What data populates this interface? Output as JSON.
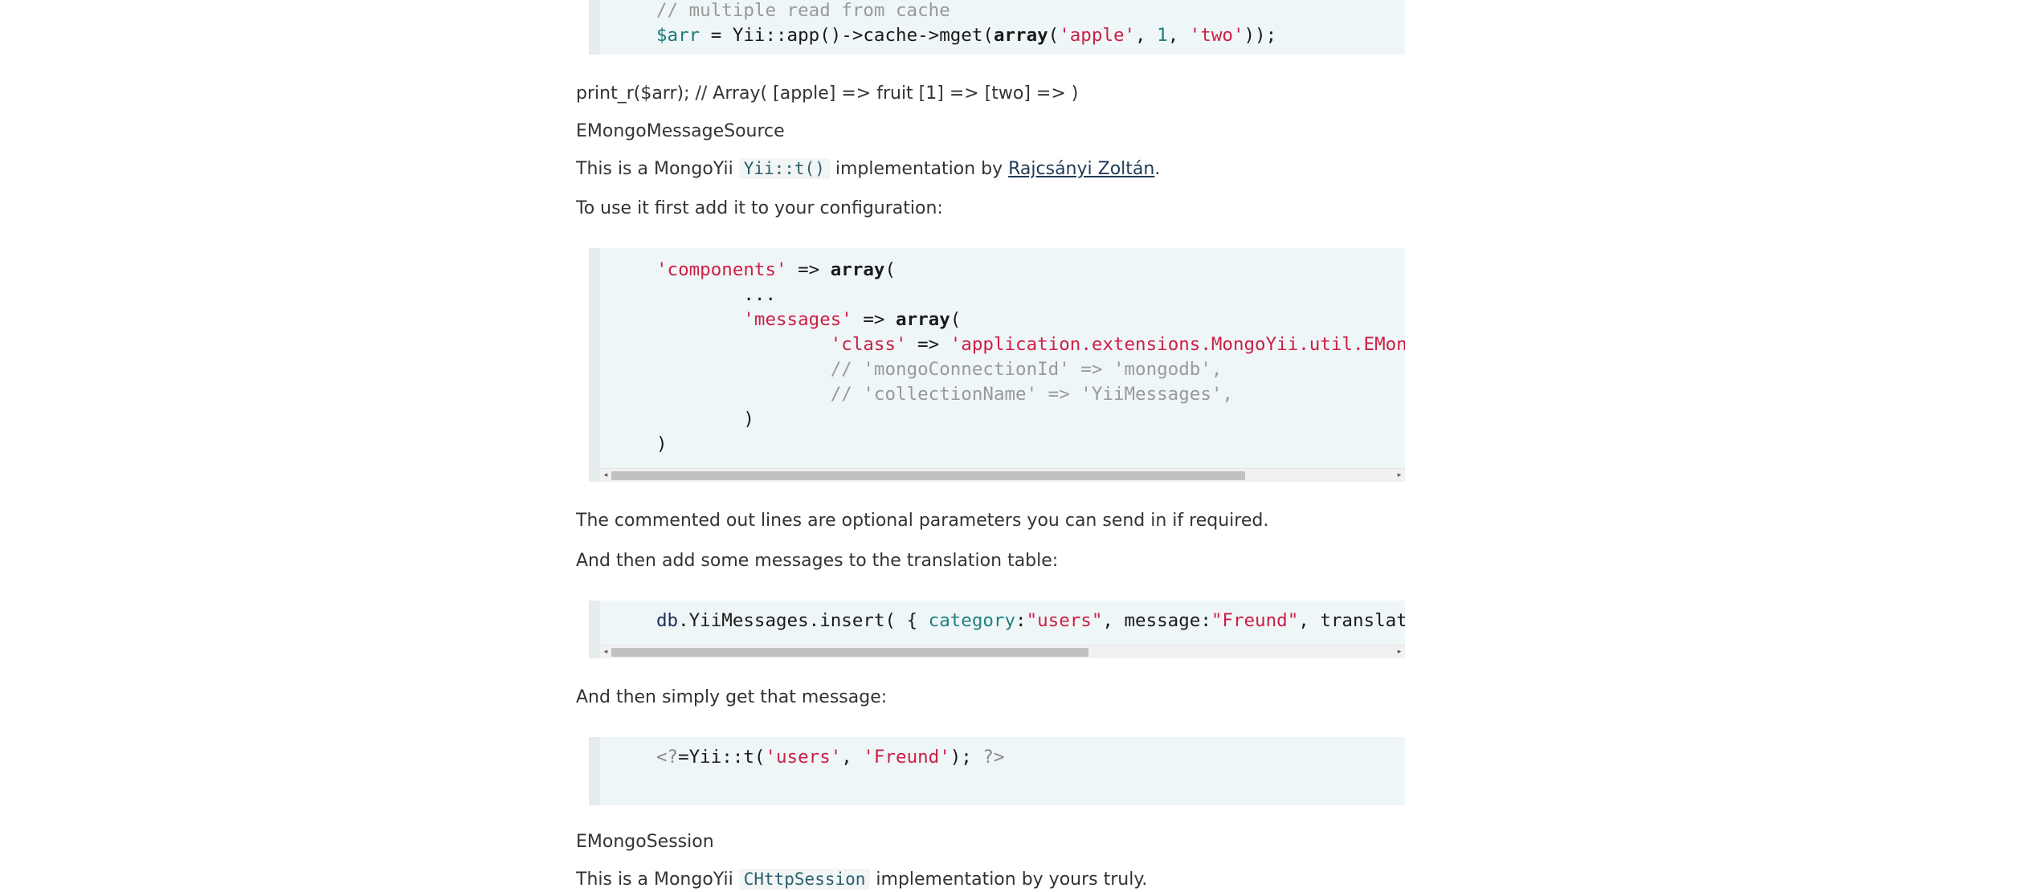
{
  "code_top": {
    "line1": "// multiple read from cache",
    "line2": {
      "var": "$arr",
      "op": " = Yii::app()->cache->mget(",
      "kw": "array",
      "p1": "(",
      "s1": "'apple'",
      "c1": ", ",
      "n1": "1",
      "c2": ", ",
      "s2": "'two'",
      "end": "));"
    }
  },
  "print_line": "print_r($arr); // Array( [apple] => fruit [1] => [two] => )",
  "heading_message_source": "EMongoMessageSource",
  "intro": {
    "before": "This is a MongoYii ",
    "code": "Yii::t()",
    "middle": " implementation by ",
    "link": "Rajcsányi Zoltán",
    "after": "."
  },
  "config_intro": "To use it first add it to your configuration:",
  "config_code": {
    "l1_str": "'components'",
    "l1_arrow": " => ",
    "l1_kw": "array",
    "l1_paren": "(",
    "l2": "...",
    "l3_str": "'messages'",
    "l3_arrow": " => ",
    "l3_kw": "array",
    "l3_paren": "(",
    "l4_str": "'class'",
    "l4_arrow": " => ",
    "l4_val": "'application.extensions.MongoYii.util.EMongoMessageSource',",
    "l5": "// 'mongoConnectionId' => 'mongodb',",
    "l6": "// 'collectionName' => 'YiiMessages',",
    "l7": ")",
    "l8": ")"
  },
  "commented_note": "The commented out lines are optional parameters you can send in if required.",
  "add_messages": "And then add some messages to the translation table:",
  "insert_code": {
    "obj": "db",
    "call": ".YiiMessages.insert( { ",
    "prop1": "category",
    "colon1": ":",
    "str1": "\"users\"",
    "sep1": ", message:",
    "str2": "\"Freund\"",
    "rest": ", translation:"
  },
  "get_message": "And then simply get that message:",
  "t_code": {
    "open": "<?",
    "call": "=Yii::t(",
    "s1": "'users'",
    "sep": ", ",
    "s2": "'Freund'",
    "end": "); ",
    "close": "?>"
  },
  "heading_session": "EMongoSession",
  "session_intro": {
    "before": "This is a MongoYii ",
    "code": "CHttpSession",
    "after": " implementation by yours truly."
  },
  "scrollbars": {
    "config_thumb_fraction": 0.81,
    "insert_thumb_fraction": 0.61
  }
}
